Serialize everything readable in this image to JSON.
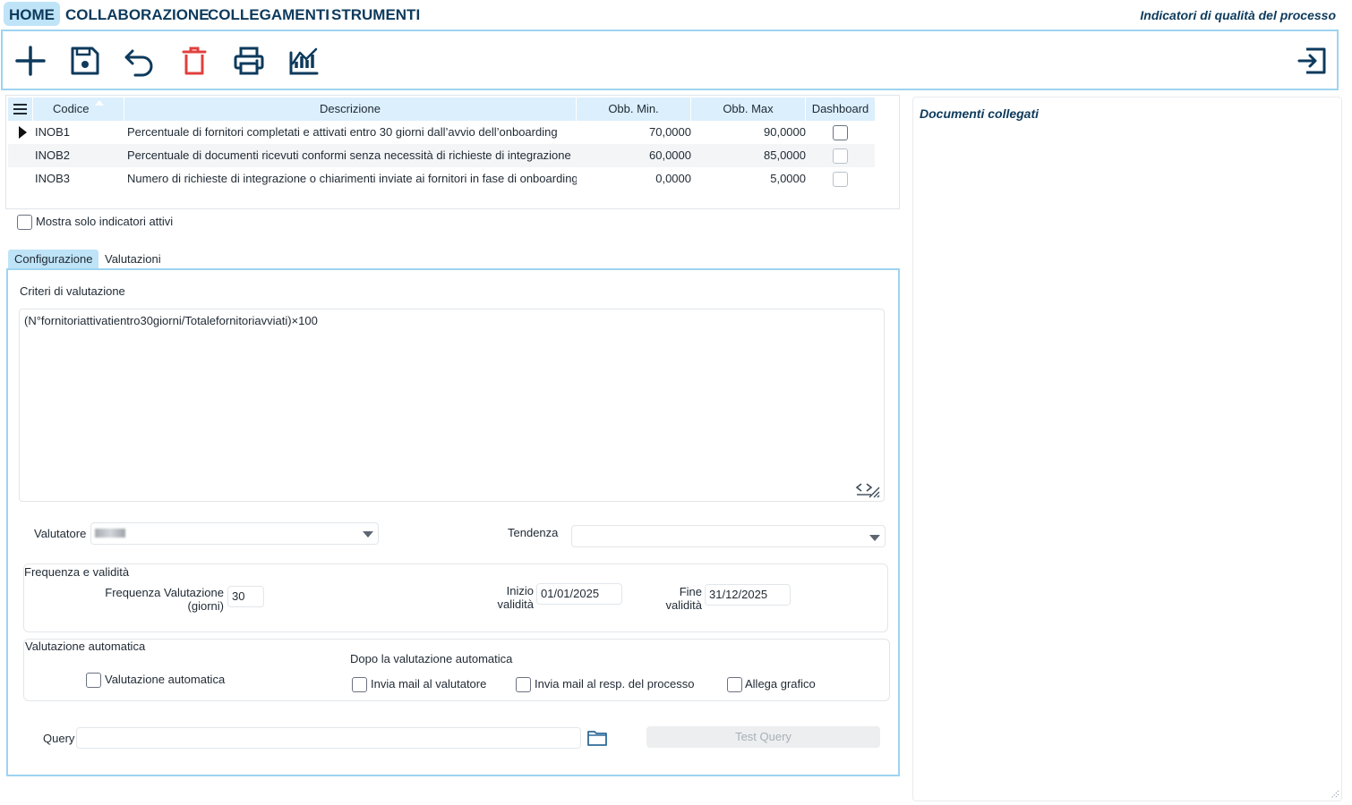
{
  "menu": {
    "home": "HOME",
    "collaborazione": "COLLABORAZIONE",
    "collegamenti": "COLLEGAMENTI",
    "strumenti": "STRUMENTI"
  },
  "page_title": "Indicatori di qualità del processo",
  "toolbar": {
    "icons": [
      "plus-icon",
      "save-icon",
      "undo-icon",
      "delete-icon",
      "print-icon",
      "chart-icon",
      "exit-icon"
    ],
    "delete_color": "#e0403c",
    "icon_color": "#0d3a5c"
  },
  "grid": {
    "columns": {
      "codice": "Codice",
      "descrizione": "Descrizione",
      "obb_min": "Obb. Min.",
      "obb_max": "Obb. Max",
      "dashboard": "Dashboard"
    },
    "rows": [
      {
        "codice": "INOB1",
        "descrizione": "Percentuale di fornitori completati e attivati entro 30 giorni dall’avvio dell’onboarding",
        "obb_min": "70,0000",
        "obb_max": "90,0000",
        "dashboard": false,
        "selected": true
      },
      {
        "codice": "INOB2",
        "descrizione": "Percentuale di documenti ricevuti conformi senza necessità di richieste di integrazione",
        "obb_min": "60,0000",
        "obb_max": "85,0000",
        "dashboard": false,
        "selected": false
      },
      {
        "codice": "INOB3",
        "descrizione": "Numero di richieste di integrazione o chiarimenti inviate ai fornitori in fase di onboarding",
        "obb_min": "0,0000",
        "obb_max": "5,0000",
        "dashboard": false,
        "selected": false
      }
    ]
  },
  "filter": {
    "only_active_label": "Mostra solo indicatori attivi"
  },
  "tabs": {
    "configurazione": "Configurazione",
    "valutazioni": "Valutazioni"
  },
  "config": {
    "criteri_label": "Criteri di valutazione",
    "criteri_value": "(N°fornitoriattivatientro30giorni/Totalefornitoriavviati)×100",
    "valutatore_label": "Valutatore",
    "tendenza_label": "Tendenza",
    "tendenza_value": "",
    "frequenza_group": "Frequenza e validità",
    "frequenza_label_1": "Frequenza Valutazione",
    "frequenza_label_2": "(giorni)",
    "frequenza_value": "30",
    "inizio_label_1": "Inizio",
    "inizio_label_2": "validità",
    "inizio_value": "01/01/2025",
    "fine_label_1": "Fine",
    "fine_label_2": "validità",
    "fine_value": "31/12/2025",
    "auto_group": "Valutazione automatica",
    "auto_checkbox_label": "Valutazione automatica",
    "dopo_label": "Dopo la valutazione automatica",
    "invia_valutatore": "Invia mail al valutatore",
    "invia_resp": "Invia mail al resp. del processo",
    "allega_grafico": "Allega grafico",
    "query_label": "Query",
    "query_value": "",
    "test_query": "Test Query"
  },
  "right_panel": {
    "title": "Documenti collegati"
  }
}
